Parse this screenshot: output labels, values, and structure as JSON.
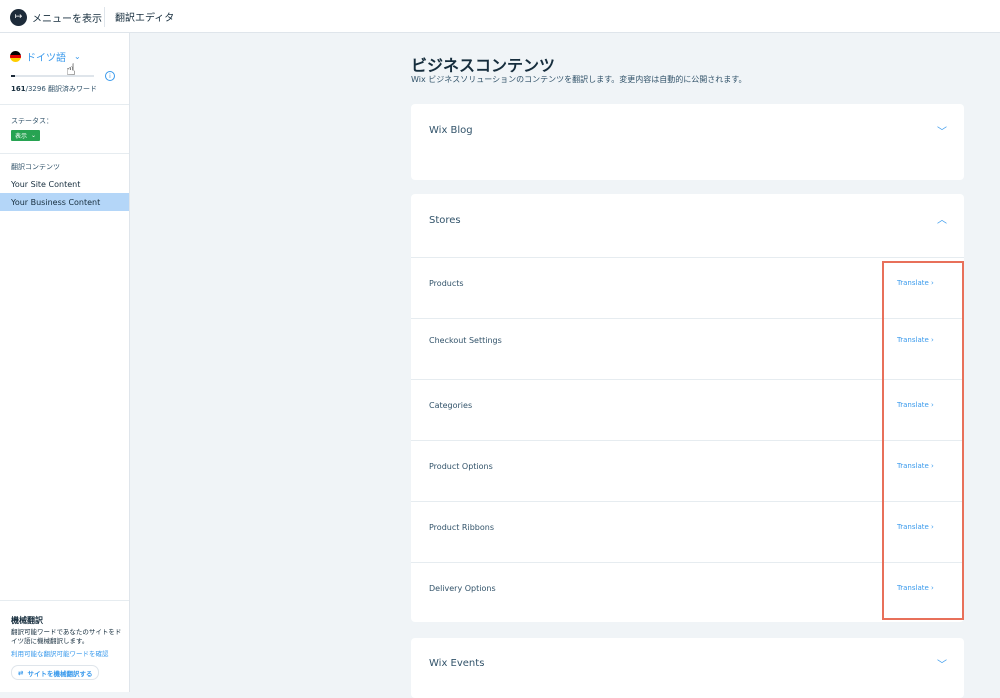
{
  "topbar": {
    "menu_icon": "sidebar-expand-icon",
    "menu_label": "メニューを表示",
    "editor_title": "翻訳エディタ"
  },
  "sidebar": {
    "language": {
      "name": "ドイツ語",
      "flag": "germany-flag-icon",
      "chevron": "chevron-down-icon"
    },
    "progress": {
      "translated": "161",
      "total": "/3296",
      "label": " 翻訳済みワード",
      "fraction": 0.049
    },
    "status": {
      "label": "ステータス：",
      "value": "表示",
      "color": "#27a352"
    },
    "contents_label": "翻訳コンテンツ",
    "nav": [
      {
        "label": "Your Site Content",
        "active": false
      },
      {
        "label": "Your Business Content",
        "active": true
      }
    ],
    "machine_translation": {
      "title": "機械翻訳",
      "description": "翻訳可能ワードであなたのサイトをドイツ語に機械翻訳します。",
      "link": "利用可能な翻訳可能ワードを確認",
      "button": "サイトを機械翻訳する"
    }
  },
  "main": {
    "title": "ビジネスコンテンツ",
    "subtitle": "Wix ビジネスソリューションのコンテンツを翻訳します。変更内容は自動的に公開されます。",
    "cards": {
      "blog": {
        "title": "Wix Blog",
        "expanded": false
      },
      "stores": {
        "title": "Stores",
        "expanded": true,
        "rows": [
          {
            "label": "Products",
            "action": "Translate"
          },
          {
            "label": "Checkout Settings",
            "action": "Translate"
          },
          {
            "label": "Categories",
            "action": "Translate"
          },
          {
            "label": "Product Options",
            "action": "Translate"
          },
          {
            "label": "Product Ribbons",
            "action": "Translate"
          },
          {
            "label": "Delivery Options",
            "action": "Translate"
          }
        ]
      },
      "events": {
        "title": "Wix Events",
        "expanded": false
      }
    }
  },
  "colors": {
    "accent": "#3899ec",
    "highlight": "#e8705a",
    "active_nav": "#b4d6f8",
    "status_green": "#27a352"
  }
}
